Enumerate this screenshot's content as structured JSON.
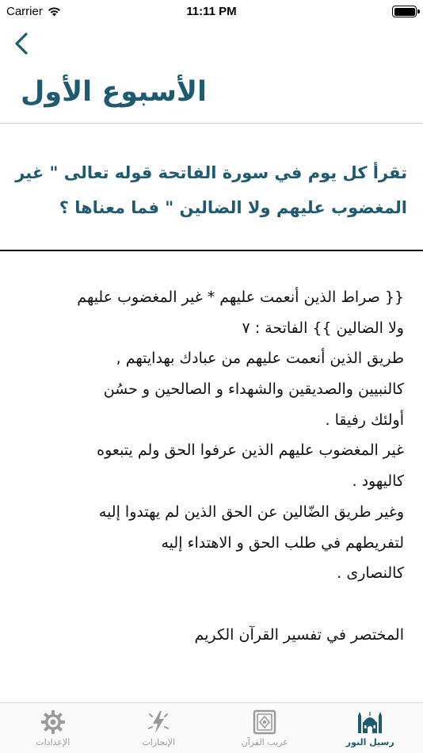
{
  "status_bar": {
    "carrier": "Carrier",
    "time": "11:11 PM",
    "icons": [
      "wifi-icon",
      "battery-icon"
    ]
  },
  "nav": {
    "back_icon": "chevron-left-icon",
    "title": "الأسبوع الأول"
  },
  "question": {
    "lines": [
      "تقرأ كل يوم في سورة الفاتحة قوله تعالى \" غير",
      "المغضوب عليهم ولا الضالين \" فما معناها ؟"
    ]
  },
  "answer": {
    "lines": [
      "{{ صراط الذين أنعمت عليهم * غير المغضوب عليهم",
      "ولا الضالين }}  الفاتحة : ٧",
      "طريق الذين أنعمت عليهم من عبادك بهدايتهم ,",
      "كالنبيين والصديقين والشهداء و الصالحين و حسُن",
      "أولئك رفيقا .",
      "غير المغضوب عليهم الذين عرفوا الحق ولم يتبعوه",
      "كاليهود .",
      "وغير طريق الضّالين عن الحق الذين لم يهتدوا إليه",
      "لتفريطهم في طلب الحق و الاهتداء إليه",
      "كالنصارى ."
    ],
    "source": "المختصر في تفسير القرآن الكريم"
  },
  "tab_bar": {
    "tabs": [
      {
        "label": "الإعدادات",
        "icon": "gear-icon",
        "active": false
      },
      {
        "label": "الإنجازات",
        "icon": "lightning-icon",
        "active": false
      },
      {
        "label": "غريب القرآن",
        "icon": "quran-book-icon",
        "active": false
      },
      {
        "label": "رسيل النور",
        "icon": "mosque-icon",
        "active": true
      }
    ]
  },
  "colors": {
    "accent": "#1f5b70",
    "inactive": "#9a9a9a"
  }
}
